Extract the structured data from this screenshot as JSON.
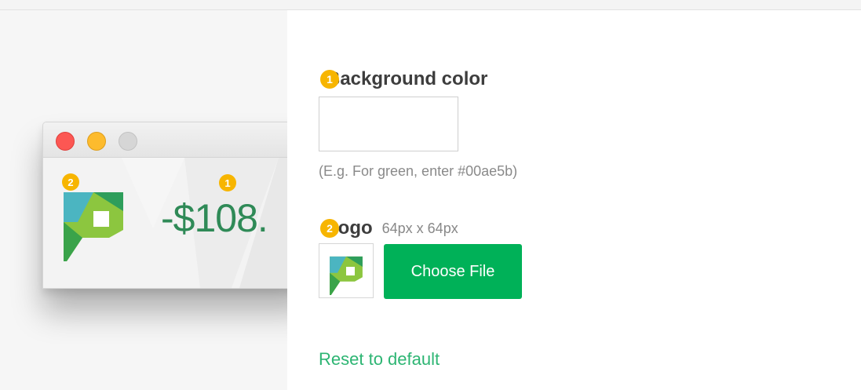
{
  "preview": {
    "amount": "-$108.",
    "badge_amount": "1",
    "badge_logo": "2",
    "icons": {
      "logo": "pocketguard-logo-icon"
    }
  },
  "panel": {
    "background": {
      "badge": "1",
      "label": "Background color",
      "value": "",
      "hint": "(E.g. For green, enter #00ae5b)"
    },
    "logo": {
      "badge": "2",
      "label": "Logo",
      "size_hint": "64px x 64px",
      "button_label": "Choose File"
    },
    "reset_label": "Reset to default"
  },
  "colors": {
    "accent_green": "#00b158",
    "link_green": "#2db573",
    "badge_yellow": "#f7b500",
    "amount_green": "#2f8a57"
  }
}
